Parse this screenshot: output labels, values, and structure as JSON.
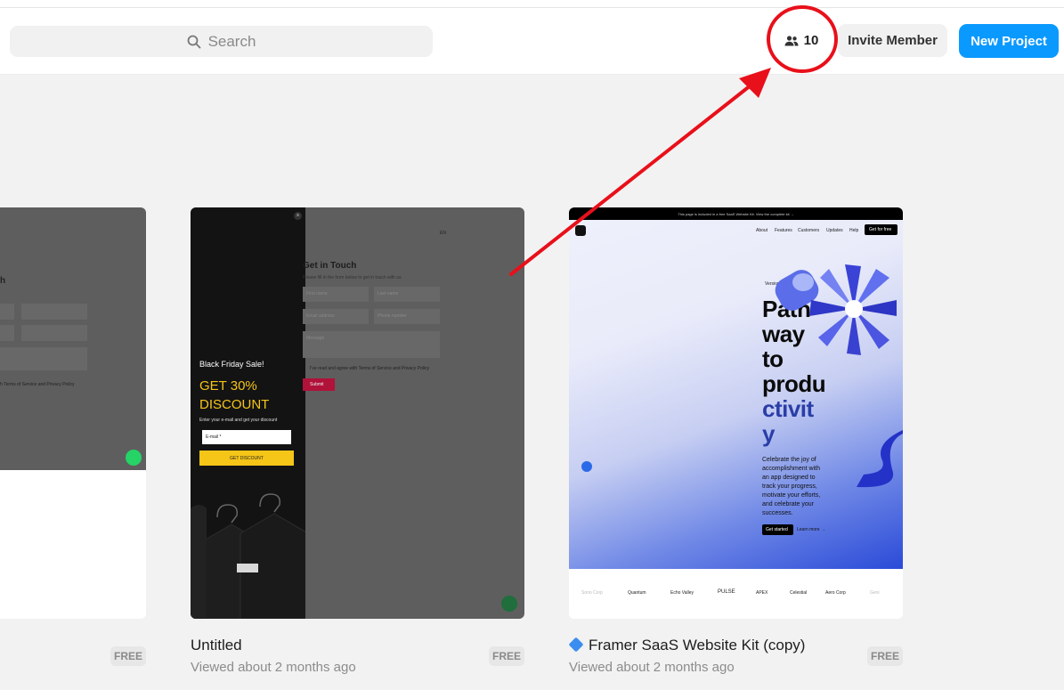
{
  "search": {
    "label": "Search"
  },
  "header": {
    "member_count": "10",
    "invite_label": "Invite Member",
    "new_project_label": "New Project"
  },
  "colors": {
    "accent": "#0a99ff",
    "annotation": "#e8101a",
    "popup_yellow": "#f5c518"
  },
  "projects": [
    {
      "title": "",
      "badge": "FREE",
      "thumb": {
        "heading": "h",
        "terms_text": "h Terms of Service and Privacy Policy"
      }
    },
    {
      "title": "Untitled",
      "subtitle": "Viewed about 2 months ago",
      "badge": "FREE",
      "thumb": {
        "popup_title": "Black Friday Sale!",
        "popup_offer": "GET 30% DISCOUNT",
        "popup_text": "Enter your e-mail and get your discount",
        "email_placeholder": "E-mail *",
        "button_label": "GET DISCOUNT",
        "heading": "Get in Touch",
        "intro": "Please fill in the form below to get in touch with us",
        "first_name": "First name",
        "last_name": "Last name",
        "email": "Email address",
        "phone": "Phone number",
        "message": "Message",
        "terms_text": "I've read and agree with Terms of Service and Privacy Policy",
        "submit_label": "Submit",
        "lang": "EN"
      }
    },
    {
      "title": "Framer SaaS Website Kit (copy)",
      "subtitle": "Viewed about 2 months ago",
      "badge": "FREE",
      "thumb": {
        "banner": "This page is included in a free SaaS Website Kit. View the complete kit →",
        "nav": [
          "About",
          "Features",
          "Customers",
          "Updates",
          "Help"
        ],
        "cta": "Get for free",
        "tag": "Version",
        "headline": [
          "Path",
          "way",
          "to",
          "produ",
          "ctivit",
          "y"
        ],
        "desc": [
          "Celebrate the joy of",
          "accomplishment with",
          "an app designed to",
          "track your progress,",
          "motivate your efforts,",
          "and celebrate your",
          "successes."
        ],
        "btn_primary": "Get started",
        "btn_secondary": "Learn more →",
        "logos": [
          "Sono Corp",
          "Quantum",
          "Echo Valley",
          "PULSE",
          "APEX",
          "Celestial",
          "Aero Corp",
          "Geni"
        ]
      }
    }
  ]
}
